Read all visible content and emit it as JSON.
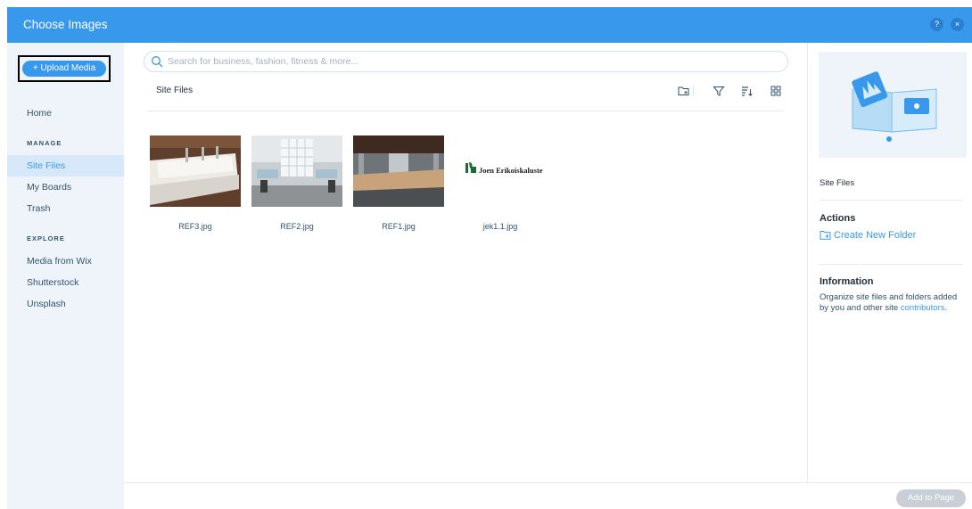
{
  "titlebar": {
    "title": "Choose Images",
    "help_glyph": "?",
    "close_glyph": "×"
  },
  "sidebar": {
    "upload_label": "+ Upload Media",
    "home": "Home",
    "manage_heading": "MANAGE",
    "manage_items": [
      "Site Files",
      "My Boards",
      "Trash"
    ],
    "explore_heading": "EXPLORE",
    "explore_items": [
      "Media from Wix",
      "Shutterstock",
      "Unsplash"
    ]
  },
  "search": {
    "placeholder": "Search for business, fashion, fitness & more...",
    "value": ""
  },
  "main": {
    "breadcrumb": "Site Files",
    "toolbar_icons": [
      "new-folder-icon",
      "filter-icon",
      "sort-icon",
      "grid-view-icon"
    ],
    "files": [
      {
        "name": "REF3.jpg"
      },
      {
        "name": "REF2.jpg"
      },
      {
        "name": "REF1.jpg"
      },
      {
        "name": "jek1.1.jpg",
        "logo_text": "Joen Erikoiskaluste"
      }
    ]
  },
  "right_panel": {
    "folder_label": "Site Files",
    "actions_heading": "Actions",
    "create_folder": "Create New Folder",
    "information_heading": "Information",
    "info_text": "Organize site files and folders added by you and other site",
    "info_link": "contributors",
    "info_end": "."
  },
  "footer": {
    "add_button": "Add to Page"
  },
  "colors": {
    "accent": "#3899ec",
    "sidebar_bg": "#eef4fa",
    "active_bg": "#d6e8f9",
    "disabled": "#c8cfd6"
  }
}
